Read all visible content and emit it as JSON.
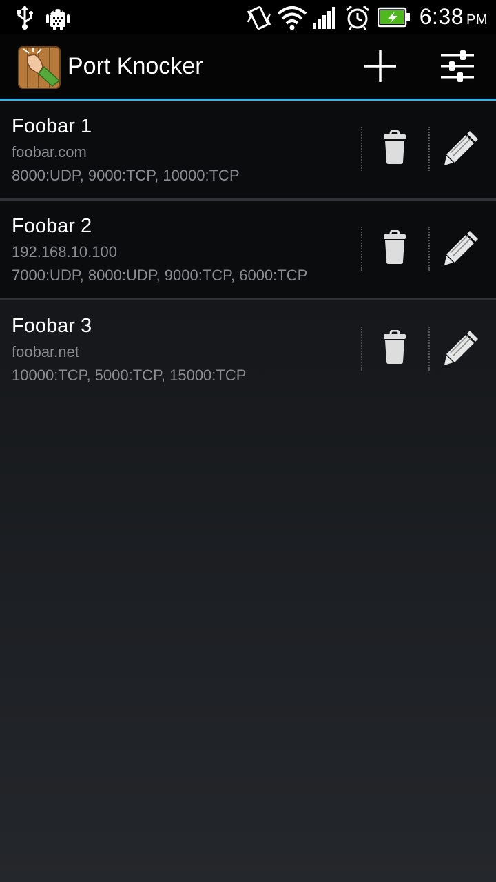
{
  "status_bar": {
    "time": "6:38",
    "ampm": "PM",
    "icons": [
      "usb-icon",
      "android-debug-icon",
      "vibrate-icon",
      "wifi-icon",
      "signal-icon",
      "alarm-icon",
      "battery-charging-icon"
    ]
  },
  "action_bar": {
    "title": "Port Knocker",
    "actions": [
      "add-icon",
      "settings-sliders-icon"
    ],
    "accent_color": "#33b5e5"
  },
  "hosts": [
    {
      "name": "Foobar 1",
      "host": "foobar.com",
      "ports": "8000:UDP, 9000:TCP, 10000:TCP"
    },
    {
      "name": "Foobar 2",
      "host": "192.168.10.100",
      "ports": "7000:UDP, 8000:UDP, 9000:TCP, 6000:TCP"
    },
    {
      "name": "Foobar 3",
      "host": "foobar.net",
      "ports": "10000:TCP, 5000:TCP, 15000:TCP"
    }
  ]
}
